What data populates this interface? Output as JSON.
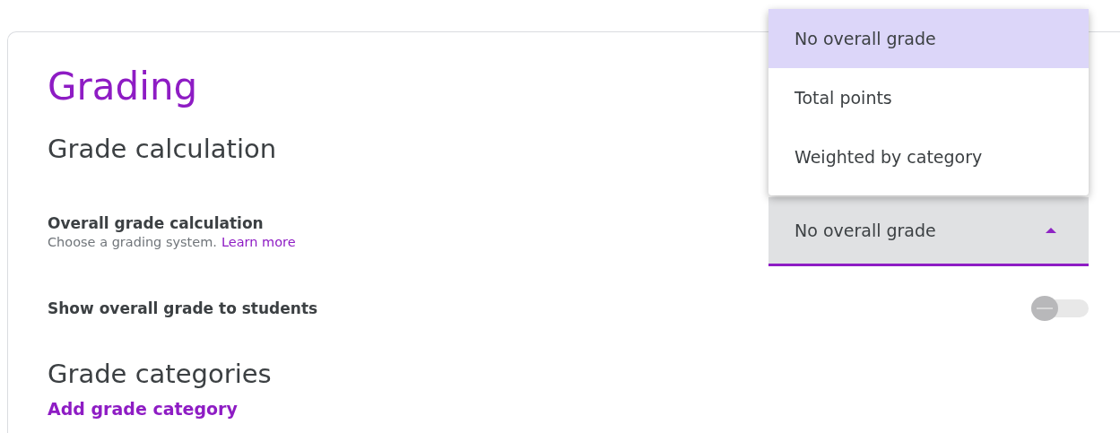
{
  "title": "Grading",
  "sections": [
    {
      "heading": "Grade calculation",
      "calculation": {
        "label": "Overall grade calculation",
        "hint": "Choose a grading system.",
        "link": "Learn more",
        "select": {
          "value": "No overall grade",
          "expanded": true,
          "options": [
            {
              "label": "No overall grade",
              "selected": true
            },
            {
              "label": "Total points",
              "selected": false
            },
            {
              "label": "Weighted by category",
              "selected": false
            }
          ]
        }
      },
      "toggle": {
        "label": "Show overall grade to students",
        "on": false
      }
    },
    {
      "heading": "Grade categories",
      "action": "Add grade category"
    }
  ]
}
